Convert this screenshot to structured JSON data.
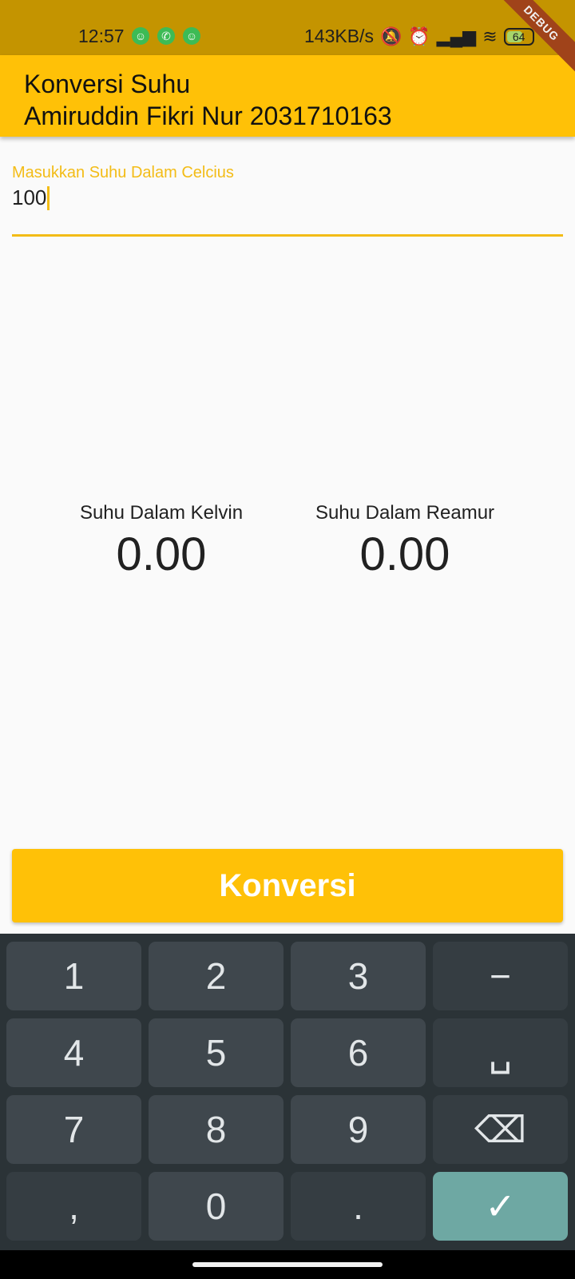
{
  "status_bar": {
    "time": "12:57",
    "notifications": [
      "app-notification-icon",
      "whatsapp-icon",
      "app-notification-icon"
    ],
    "network_speed": "143KB/s",
    "battery": "64",
    "battery_level": 0.64,
    "debug_banner": "DEBUG"
  },
  "app_bar": {
    "title_line1": "Konversi Suhu",
    "title_line2": "Amiruddin Fikri Nur 2031710163",
    "color": "#ffc107"
  },
  "input": {
    "label": "Masukkan Suhu Dalam Celcius",
    "value": "100",
    "accent": "#f3bc16"
  },
  "results": {
    "kelvin": {
      "label": "Suhu Dalam Kelvin",
      "value": "0.00"
    },
    "reamur": {
      "label": "Suhu Dalam Reamur",
      "value": "0.00"
    }
  },
  "button": {
    "label": "Konversi"
  },
  "keyboard": {
    "rows": [
      [
        "1",
        "2",
        "3",
        "−"
      ],
      [
        "4",
        "5",
        "6",
        "␣"
      ],
      [
        "7",
        "8",
        "9",
        "⌫"
      ],
      [
        ",",
        "0",
        ".",
        "✓"
      ]
    ]
  }
}
